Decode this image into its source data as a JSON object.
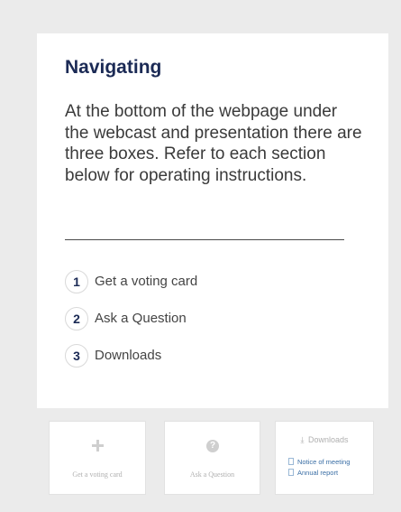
{
  "card": {
    "title": "Navigating",
    "description": "At the bottom of the webpage under the webcast and presentation there are three boxes. Refer to each section below for operating instructions.",
    "steps": [
      {
        "number": "1",
        "label": "Get a voting card"
      },
      {
        "number": "2",
        "label": "Ask a Question"
      },
      {
        "number": "3",
        "label": "Downloads"
      }
    ]
  },
  "boxes": {
    "voting": {
      "icon": "plus-icon",
      "label": "Get a voting card"
    },
    "question": {
      "icon": "question-icon",
      "glyph": "?",
      "label": "Ask a Question"
    },
    "downloads": {
      "icon": "download-icon",
      "glyph": "⤓",
      "title": "Downloads",
      "links": [
        "Notice of meeting",
        "Annual report"
      ]
    }
  },
  "colors": {
    "title": "#1b2a55",
    "link": "#3a6ea5",
    "background": "#ebebeb"
  }
}
